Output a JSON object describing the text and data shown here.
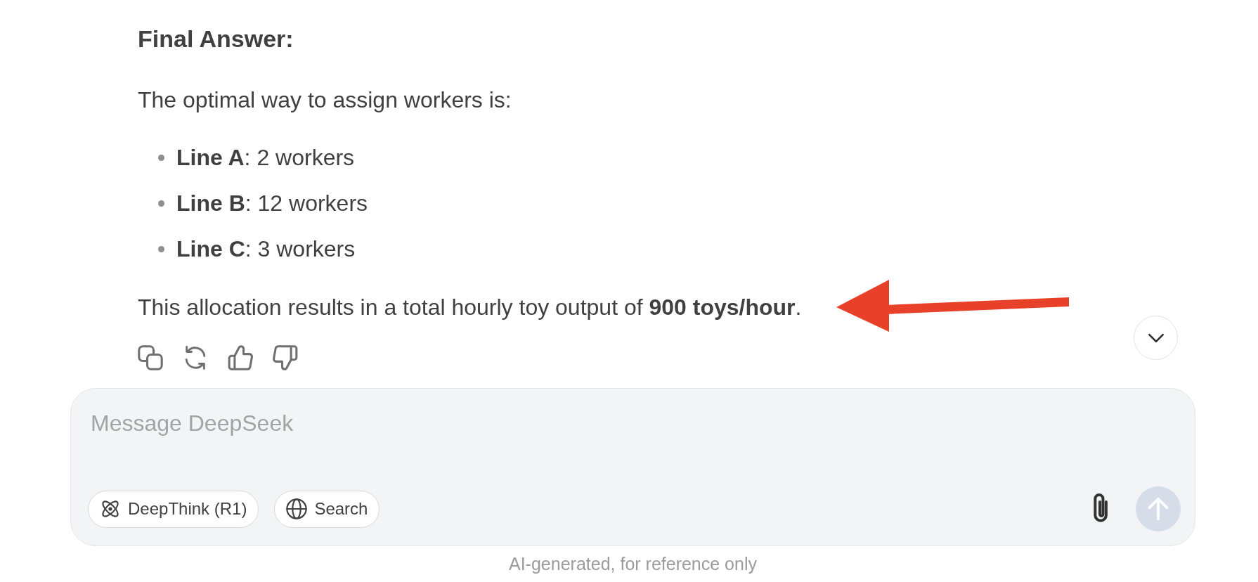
{
  "message": {
    "heading": "Final Answer:",
    "intro": "The optimal way to assign workers is:",
    "items": [
      "**Line A**: 2 workers",
      "**Line B**: 12 workers",
      "**Line C**: 3 workers"
    ],
    "conclusion": "This allocation results in a total hourly toy output of **900 toys/hour**."
  },
  "composer": {
    "placeholder": "Message DeepSeek",
    "toggles": [
      {
        "kind": "reasoning",
        "label": "DeepThink (R1)",
        "on": false
      },
      {
        "kind": "web",
        "label": "Search",
        "on": false
      }
    ],
    "send": {
      "disabled": true
    }
  },
  "footer": {
    "note": "AI-generated, for reference only"
  }
}
